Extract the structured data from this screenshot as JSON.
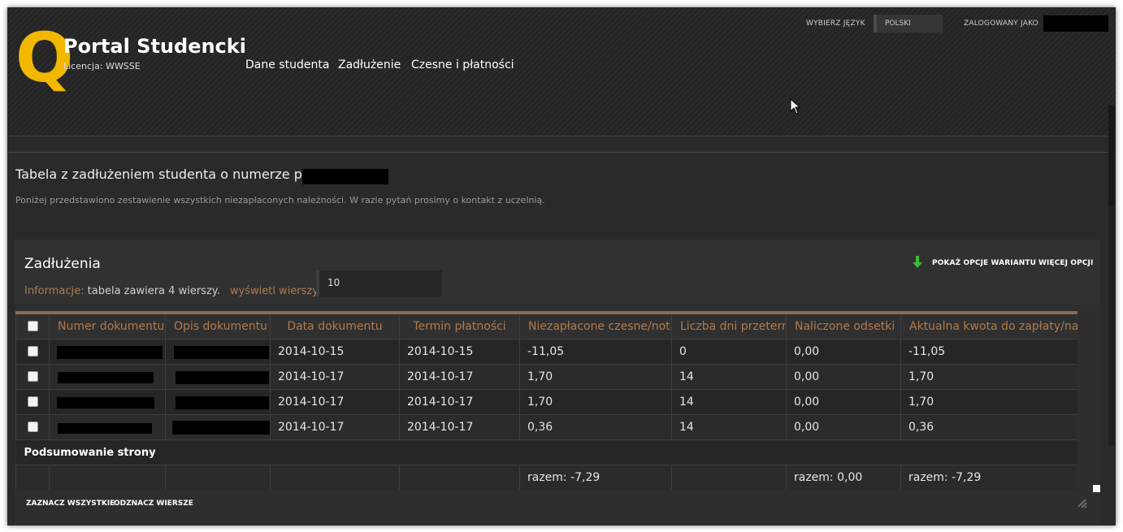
{
  "app": {
    "title": "Portal Studencki",
    "logo_letter": "Q",
    "license": "Licencja: WWSSE",
    "colors": {
      "logo": "#f2b800",
      "accent": "#b07a4c",
      "header_rule": "#8a6c52",
      "arrow": "#3dbb3d"
    }
  },
  "topbar": {
    "language_label": "WYBIERZ JĘZYK",
    "language_value": "POLSKI",
    "logged_label": "ZALOGOWANY JAKO"
  },
  "nav": [
    {
      "label": "Dane studenta"
    },
    {
      "label": "Zadłużenie"
    },
    {
      "label": "Czesne i płatności"
    }
  ],
  "page": {
    "heading": "Tabela z zadłużeniem studenta o numerze pesel:",
    "description": "Poniżej przedstawiono zestawienie wszystkich niezapłaconych należności. W razie pytań prosimy o kontakt z uczelnią."
  },
  "panel": {
    "title": "Zadłużenia",
    "info_label": "Informacje:",
    "info_text_pre": "tabela zawiera",
    "info_count": "4",
    "info_text_post": "wierszy.",
    "rows_label": "wyświetl wierszy:",
    "rows_value": "10",
    "show_variant_options": "POKAŻ OPCJE WARIANTU",
    "more_options": "WIĘCEJ OPCJI",
    "arrow_icon": "download-arrow-icon"
  },
  "table": {
    "headers": [
      "Numer dokumentu",
      "Opis dokumentu",
      "Data dokumentu",
      "Termin płatności",
      "Niezapłacone czesne/nota obciążeniowa",
      "Liczba dni przeterminowania",
      "Naliczone odsetki",
      "Aktualna kwota do zapłaty/nadpłaty"
    ],
    "rows": [
      {
        "data_dok": "2014-10-15",
        "termin": "2014-10-15",
        "niezaplacone": "-11,05",
        "dni": "0",
        "odsetki": "0,00",
        "kwota": "-11,05"
      },
      {
        "data_dok": "2014-10-17",
        "termin": "2014-10-17",
        "niezaplacone": "1,70",
        "dni": "14",
        "odsetki": "0,00",
        "kwota": "1,70"
      },
      {
        "data_dok": "2014-10-17",
        "termin": "2014-10-17",
        "niezaplacone": "1,70",
        "dni": "14",
        "odsetki": "0,00",
        "kwota": "1,70"
      },
      {
        "data_dok": "2014-10-17",
        "termin": "2014-10-17",
        "niezaplacone": "0,36",
        "dni": "14",
        "odsetki": "0,00",
        "kwota": "0,36"
      }
    ],
    "summary_label": "Podsumowanie strony",
    "summary": {
      "niezaplacone": "razem: -7,29",
      "odsetki": "razem: 0,00",
      "kwota": "razem: -7,29"
    }
  },
  "footer": {
    "select_all": "ZAZNACZ WSZYSTKIE",
    "deselect": "ODZNACZ WIERSZE"
  }
}
